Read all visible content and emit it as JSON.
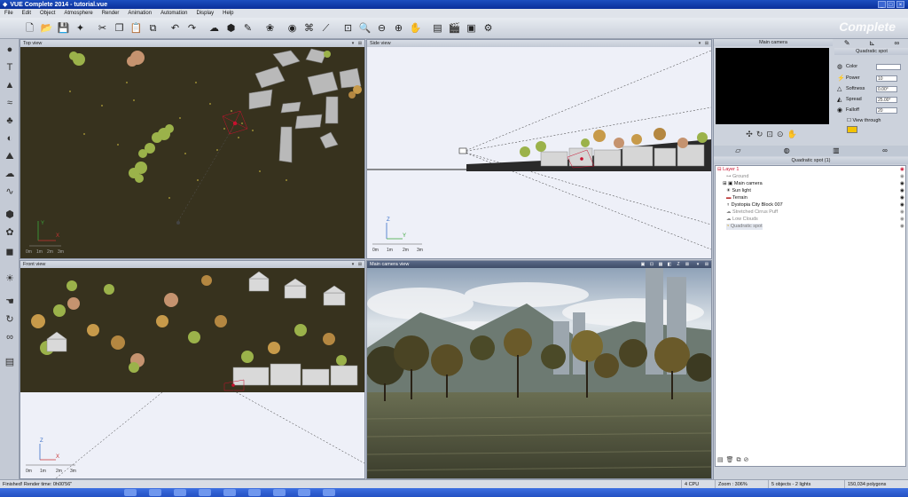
{
  "titlebar": {
    "title": "VUE Complete 2014 - tutorial.vue",
    "controls": [
      "_",
      "□",
      "×"
    ]
  },
  "menu": [
    "File",
    "Edit",
    "Object",
    "Atmosphere",
    "Render",
    "Animation",
    "Automation",
    "Display",
    "Help"
  ],
  "brand": "Complete",
  "viewports": {
    "top": {
      "title": "Top view"
    },
    "side": {
      "title": "Side view"
    },
    "front": {
      "title": "Front view"
    },
    "camera": {
      "title": "Main camera view"
    }
  },
  "scale_labels": [
    "0m",
    "1m",
    "2m",
    "3m"
  ],
  "axes": {
    "z": "Z",
    "y": "Y",
    "x": "X"
  },
  "right_panel": {
    "camera_header": "Main camera",
    "object_header": "Quadratic spot",
    "props": [
      {
        "label": "Color",
        "value": ""
      },
      {
        "label": "Power",
        "value": "10"
      },
      {
        "label": "Softness",
        "value": "0.00°"
      },
      {
        "label": "Spread",
        "value": "25.00°"
      },
      {
        "label": "Falloff",
        "value": "20"
      }
    ],
    "view_through": "View through",
    "tree_header": "Quadratic spot (1)",
    "tree": [
      {
        "label": "Layer 1",
        "level": 0
      },
      {
        "label": "Ground",
        "level": 1
      },
      {
        "label": "Main camera",
        "level": 1
      },
      {
        "label": "Sun light",
        "level": 1
      },
      {
        "label": "Terrain",
        "level": 1
      },
      {
        "label": "Dystopia City Block 007",
        "level": 1
      },
      {
        "label": "Stretched Cirrus Puff",
        "level": 1
      },
      {
        "label": "Low Clouds",
        "level": 1
      },
      {
        "label": "Quadratic spot",
        "level": 1
      }
    ]
  },
  "status": {
    "message": "Finished! Render time: 0h00'56\"",
    "cpu": "4 CPU",
    "zoom": "Zoom : 306%",
    "objects": "5 objects - 2 lights",
    "polygons": "150,034 polygons"
  },
  "colors": {
    "titlebar": "#1d4fc0",
    "viewport_dark": "#37321e",
    "viewport_light": "#eef0f8",
    "selection": "#c8102e"
  }
}
